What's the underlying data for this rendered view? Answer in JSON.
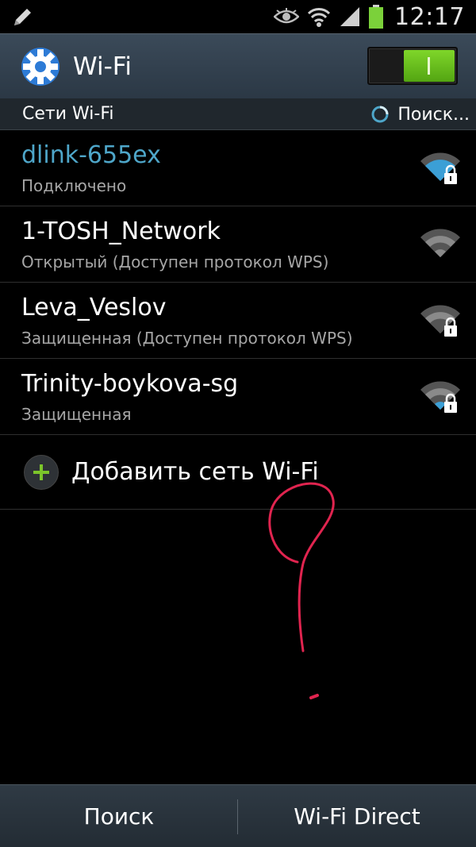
{
  "status_bar": {
    "time": "12:17",
    "icons": [
      "pencil-icon",
      "eye-icon",
      "wifi-status-icon",
      "cell-signal-icon",
      "battery-icon"
    ],
    "battery_color": "#7bd13a"
  },
  "action_bar": {
    "title": "Wi-Fi",
    "icon": "gear-icon",
    "toggle_on": true,
    "toggle_color": "#6cc21f"
  },
  "section": {
    "label": "Сети Wi-Fi",
    "scanning_text": "Поиск..."
  },
  "networks": [
    {
      "ssid": "dlink-655ex",
      "status": "Подключено",
      "connected": true,
      "secured": true
    },
    {
      "ssid": "1-TOSH_Network",
      "status": "Открытый (Доступен протокол WPS)",
      "connected": false,
      "secured": false
    },
    {
      "ssid": "Leva_Veslov",
      "status": "Защищенная (Доступен протокол WPS)",
      "connected": false,
      "secured": true
    },
    {
      "ssid": "Trinity-boykova-sg",
      "status": "Защищенная",
      "connected": false,
      "secured": true
    }
  ],
  "add_network": {
    "label": "Добавить сеть Wi-Fi",
    "icon": "plus-icon"
  },
  "bottom_bar": {
    "scan_label": "Поиск",
    "wifi_direct_label": "Wi-Fi Direct"
  },
  "colors": {
    "connected_ssid": "#4ea6c9",
    "doodle": "#e0244f",
    "accent_green": "#7cc52a"
  }
}
